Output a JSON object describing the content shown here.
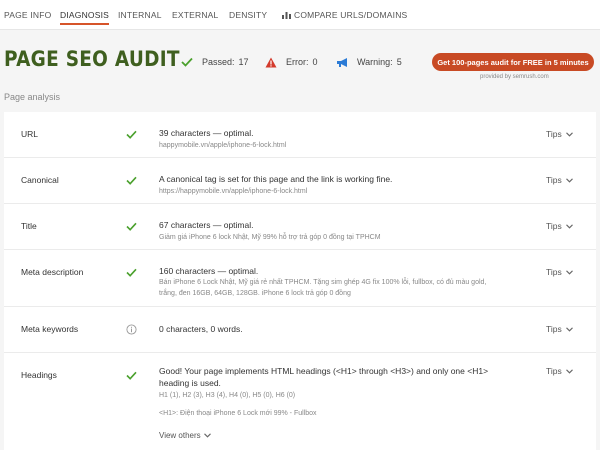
{
  "nav": {
    "tabs": [
      {
        "label": "PAGE INFO"
      },
      {
        "label": "DIAGNOSIS"
      },
      {
        "label": "INTERNAL"
      },
      {
        "label": "EXTERNAL"
      },
      {
        "label": "DENSITY"
      },
      {
        "label": "COMPARE URLS/DOMAINS"
      }
    ],
    "active_tab": "DIAGNOSIS"
  },
  "header": {
    "title": "PAGE SEO AUDIT",
    "passed_label": "Passed:",
    "passed_count": "17",
    "error_label": "Error:",
    "error_count": "0",
    "warning_label": "Warning:",
    "warning_count": "5",
    "promo_label": "Get 100-pages audit for FREE in 5 minutes",
    "provided_by": "provided by semrush.com"
  },
  "section_label": "Page analysis",
  "rows": [
    {
      "name": "URL",
      "status": "check-icon",
      "main": "39 characters — optimal.",
      "sub": "happymobile.vn/apple/iphone-6-lock.html",
      "tips": "Tips"
    },
    {
      "name": "Canonical",
      "status": "check-icon",
      "main": "A canonical tag is set for this page and the link is working fine.",
      "sub": "https://happymobile.vn/apple/iphone-6-lock.html",
      "tips": "Tips"
    },
    {
      "name": "Title",
      "status": "check-icon",
      "main": "67 characters — optimal.",
      "sub": "Giảm giá iPhone 6 lock Nhật, Mỹ 99% hỗ trợ trả góp 0 đồng tại TPHCM",
      "tips": "Tips"
    },
    {
      "name": "Meta description",
      "status": "check-icon",
      "main": "160 characters — optimal.",
      "sub": "Bán iPhone 6 Lock Nhật, Mỹ giá rẻ nhất TPHCM. Tặng sim ghép 4G fix 100% lỗi, fullbox, có đủ màu gold, trắng, đen 16GB, 64GB, 128GB. iPhone 6 lock trả góp 0 đồng",
      "tips": "Tips"
    },
    {
      "name": "Meta keywords",
      "status": "info-icon",
      "main": "0 characters, 0 words.",
      "sub": "",
      "tips": "Tips"
    },
    {
      "name": "Headings",
      "status": "check-icon",
      "main": "Good! Your page implements HTML headings (<H1> through <H3>) and only one <H1> heading is used.",
      "sub": "H1 (1), H2 (3), H3 (4), H4 (0), H5 (0), H6 (0)",
      "sub2": "<H1>: Điện thoại iPhone 6 Lock mới 99% - Fullbox",
      "view_others": "View others",
      "tips": "Tips"
    }
  ],
  "colors": {
    "accent": "#d6542a",
    "title_green": "#3f5f1f",
    "check_green": "#4aa02c",
    "error_red": "#d33a2c",
    "warning_blue": "#2b7bd6",
    "promo_bg": "#c84a24"
  }
}
